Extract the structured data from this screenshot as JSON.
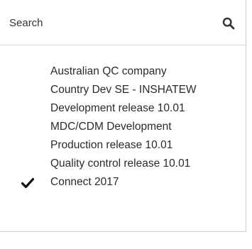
{
  "search": {
    "placeholder": "Search",
    "icon": "search-icon"
  },
  "items": [
    {
      "label": "Australian QC company",
      "selected": false
    },
    {
      "label": "Country Dev SE - INSHATEW",
      "selected": false
    },
    {
      "label": "Development release 10.01",
      "selected": false
    },
    {
      "label": "MDC/CDM Development",
      "selected": false
    },
    {
      "label": "Production release 10.01",
      "selected": false
    },
    {
      "label": "Quality control release 10.01",
      "selected": false
    },
    {
      "label": "Connect 2017",
      "selected": true
    }
  ],
  "colors": {
    "text": "#2b2b2b",
    "border": "#cfcfcf",
    "icon": "#333333"
  }
}
